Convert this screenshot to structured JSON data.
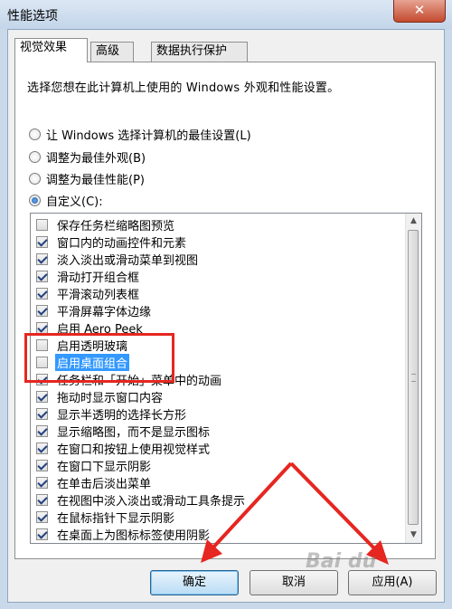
{
  "window": {
    "title": "性能选项",
    "close_symbol": "✕"
  },
  "tabs": [
    "视觉效果",
    "高级",
    "数据执行保护"
  ],
  "description": "选择您想在此计算机上使用的 Windows 外观和性能设置。",
  "radios": [
    {
      "label": "让 Windows 选择计算机的最佳设置(L)",
      "selected": false
    },
    {
      "label": "调整为最佳外观(B)",
      "selected": false
    },
    {
      "label": "调整为最佳性能(P)",
      "selected": false
    },
    {
      "label": "自定义(C):",
      "selected": true
    }
  ],
  "effects": [
    {
      "label": "保存任务栏缩略图预览",
      "checked": false
    },
    {
      "label": "窗口内的动画控件和元素",
      "checked": true
    },
    {
      "label": "淡入淡出或滑动菜单到视图",
      "checked": true
    },
    {
      "label": "滑动打开组合框",
      "checked": true
    },
    {
      "label": "平滑滚动列表框",
      "checked": true
    },
    {
      "label": "平滑屏幕字体边缘",
      "checked": true
    },
    {
      "label": "启用 Aero Peek",
      "checked": true
    },
    {
      "label": "启用透明玻璃",
      "checked": false
    },
    {
      "label": "启用桌面组合",
      "checked": false,
      "selected": true
    },
    {
      "label": "任务栏和「开始」菜单中的动画",
      "checked": true
    },
    {
      "label": "拖动时显示窗口内容",
      "checked": true
    },
    {
      "label": "显示半透明的选择长方形",
      "checked": true
    },
    {
      "label": "显示缩略图，而不是显示图标",
      "checked": true
    },
    {
      "label": "在窗口和按钮上使用视觉样式",
      "checked": true
    },
    {
      "label": "在窗口下显示阴影",
      "checked": true
    },
    {
      "label": "在单击后淡出菜单",
      "checked": true
    },
    {
      "label": "在视图中淡入淡出或滑动工具条提示",
      "checked": true
    },
    {
      "label": "在鼠标指针下显示阴影",
      "checked": true
    },
    {
      "label": "在桌面上为图标标签使用阴影",
      "checked": true
    }
  ],
  "buttons": {
    "ok": "确定",
    "cancel": "取消",
    "apply": "应用(A)"
  },
  "watermark": "Bai du",
  "colors": {
    "annotation_red": "#e62620",
    "selection_blue": "#3399ff"
  }
}
